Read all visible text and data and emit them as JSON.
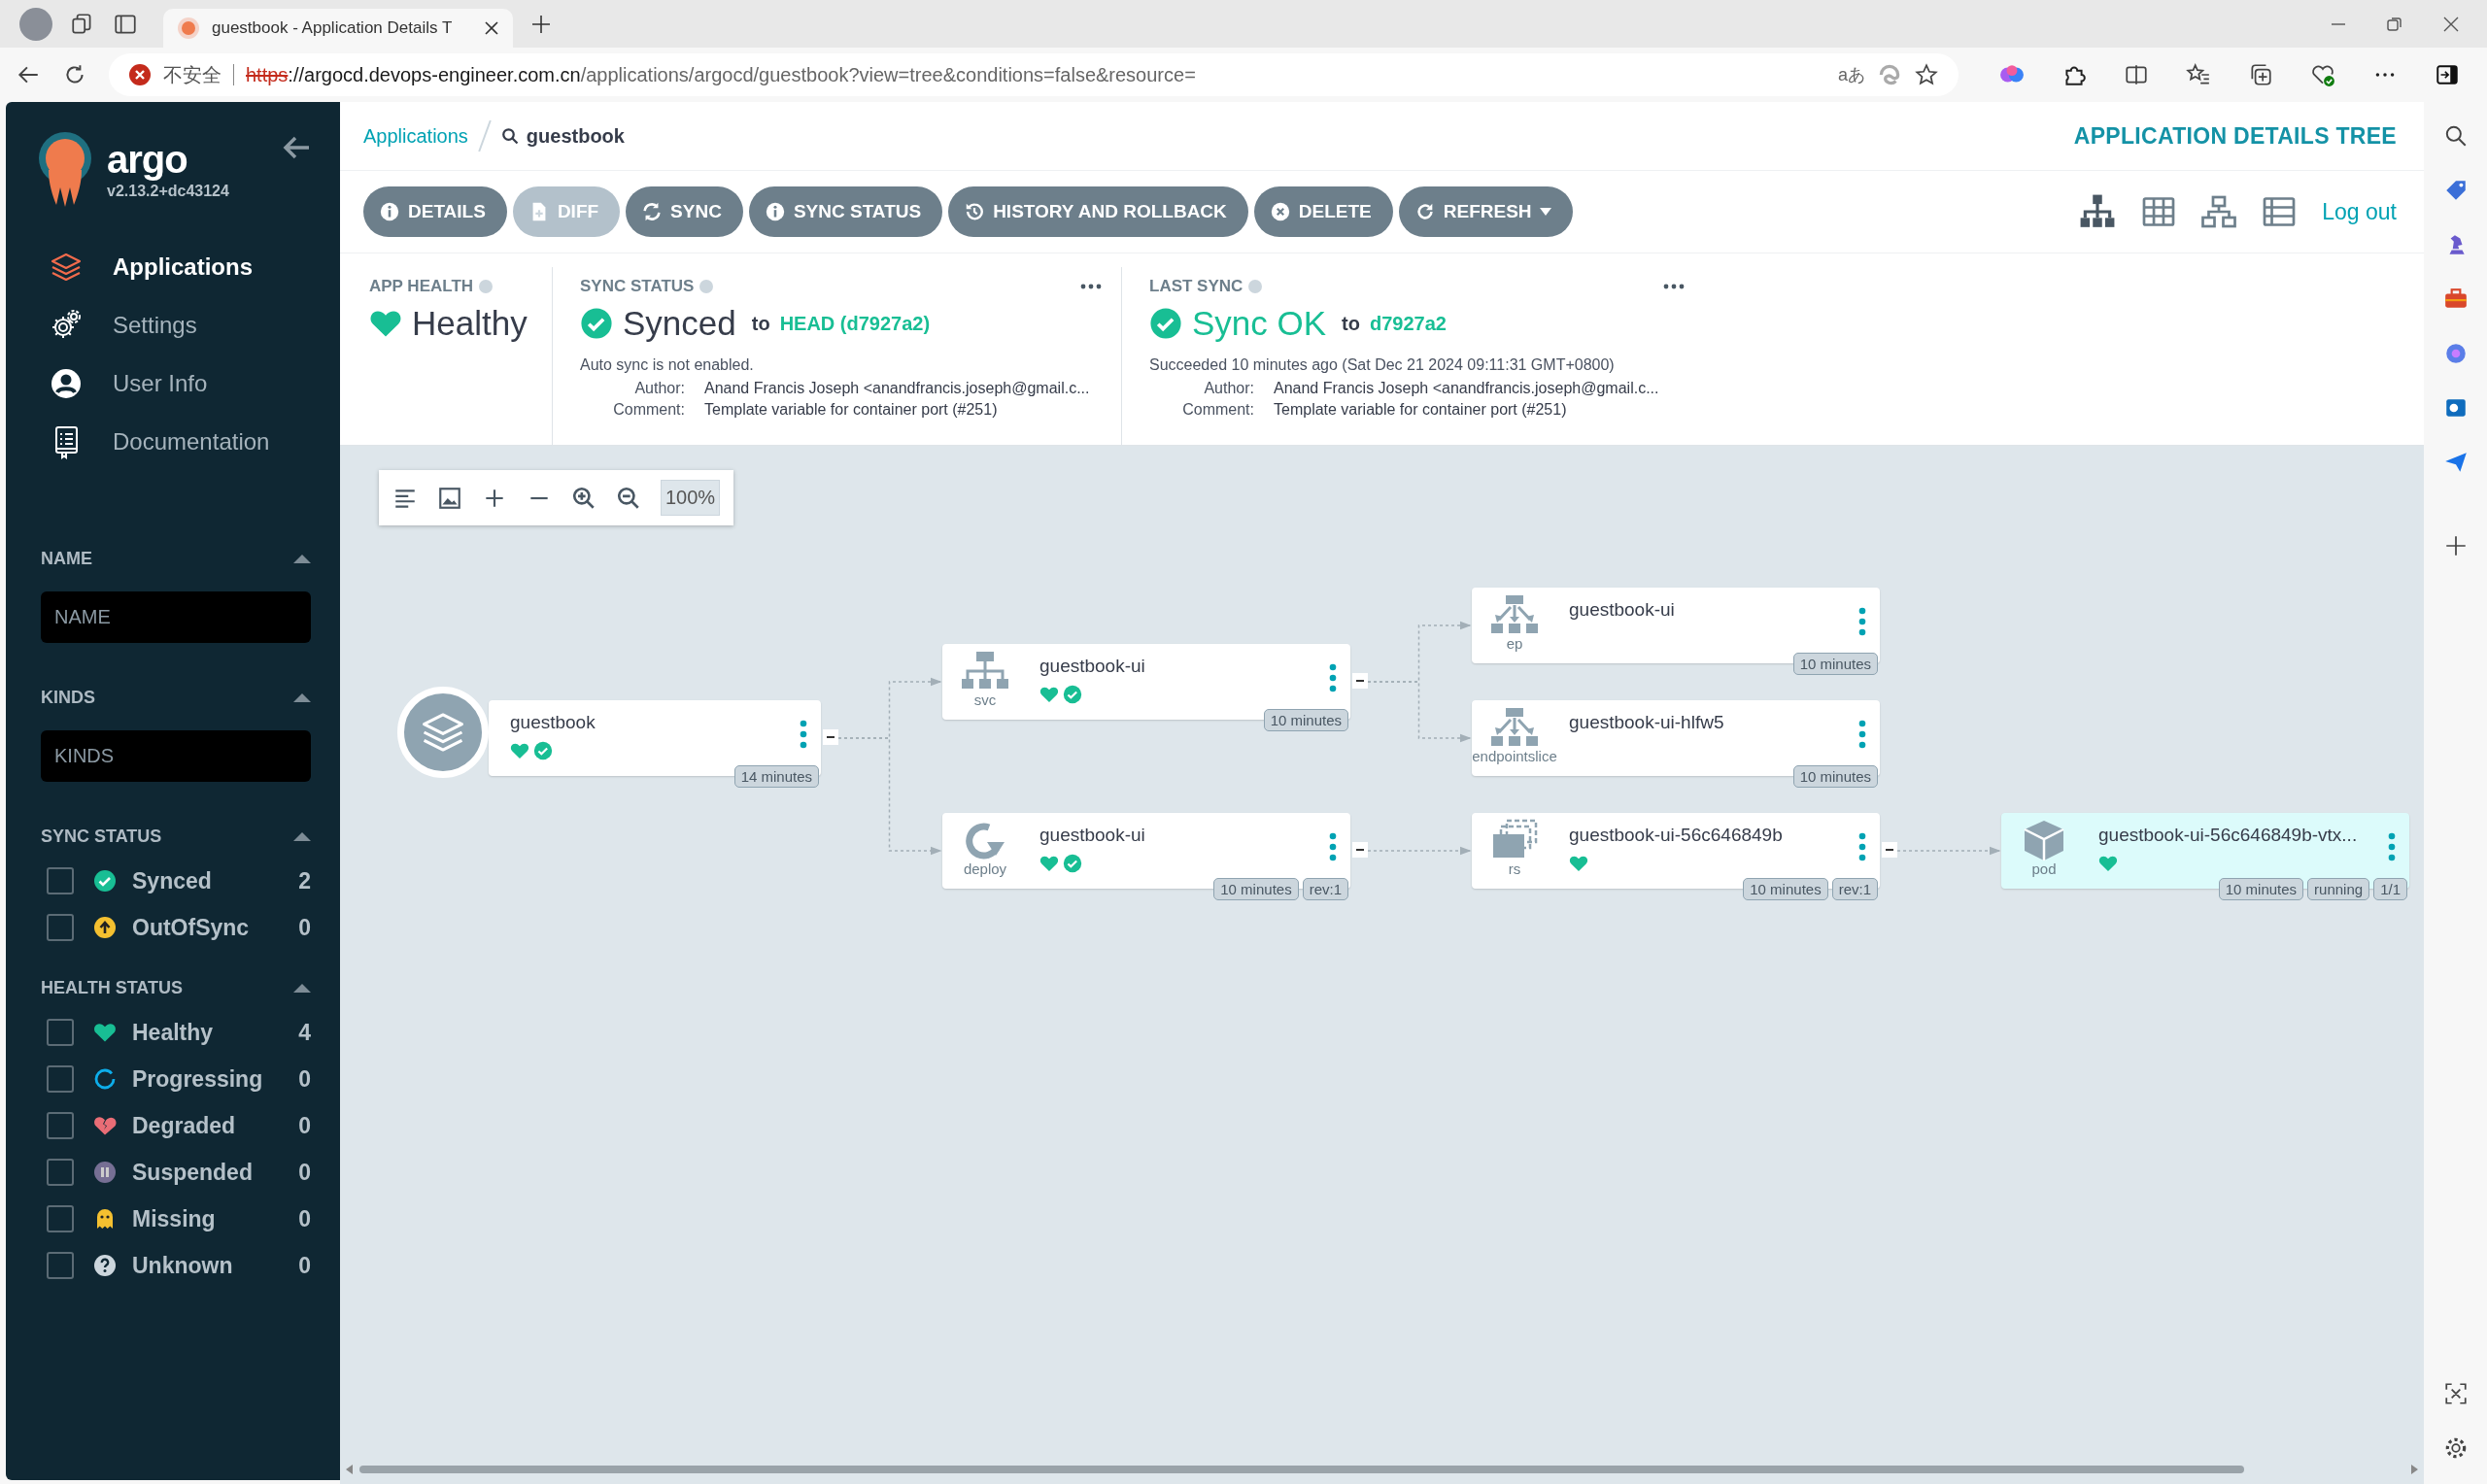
{
  "browser": {
    "tab_title": "guestbook - Application Details T",
    "security_label": "不安全",
    "url": {
      "scheme": "https",
      "host": "://argocd.devops-engineer.com.cn",
      "path": "/applications/argocd/guestbook?view=tree&conditions=false&resource="
    },
    "translate_glyph": "aあ"
  },
  "sidebar": {
    "brand": "argo",
    "version": "v2.13.2+dc43124",
    "nav": [
      {
        "kind": "applications",
        "label": "Applications",
        "selected": true
      },
      {
        "kind": "settings",
        "label": "Settings",
        "selected": false
      },
      {
        "kind": "user",
        "label": "User Info",
        "selected": false
      },
      {
        "kind": "docs",
        "label": "Documentation",
        "selected": false
      }
    ],
    "filters": [
      {
        "kind": "text",
        "title": "NAME",
        "placeholder": "NAME"
      },
      {
        "kind": "text",
        "title": "KINDS",
        "placeholder": "KINDS"
      },
      {
        "kind": "checklist",
        "title": "SYNC STATUS",
        "items": [
          {
            "kind": "synced",
            "label": "Synced",
            "count": "2",
            "checked": false
          },
          {
            "kind": "outofsync",
            "label": "OutOfSync",
            "count": "0",
            "checked": false
          }
        ]
      },
      {
        "kind": "checklist",
        "title": "HEALTH STATUS",
        "items": [
          {
            "kind": "healthy",
            "label": "Healthy",
            "count": "4",
            "checked": false
          },
          {
            "kind": "progressing",
            "label": "Progressing",
            "count": "0",
            "checked": false
          },
          {
            "kind": "degraded",
            "label": "Degraded",
            "count": "0",
            "checked": false
          },
          {
            "kind": "suspended",
            "label": "Suspended",
            "count": "0",
            "checked": false
          },
          {
            "kind": "missing",
            "label": "Missing",
            "count": "0",
            "checked": false
          },
          {
            "kind": "unknown",
            "label": "Unknown",
            "count": "0",
            "checked": false
          }
        ]
      }
    ]
  },
  "header": {
    "breadcrumb": [
      {
        "kind": "link",
        "label": "Applications"
      },
      {
        "kind": "search",
        "label": "guestbook"
      }
    ],
    "title": "APPLICATION DETAILS TREE",
    "actions": [
      {
        "kind": "details",
        "label": "DETAILS",
        "disabled": false
      },
      {
        "kind": "diff",
        "label": "DIFF",
        "disabled": true
      },
      {
        "kind": "sync",
        "label": "SYNC",
        "disabled": false
      },
      {
        "kind": "details",
        "label": "SYNC STATUS",
        "disabled": false
      },
      {
        "kind": "history",
        "label": "HISTORY AND ROLLBACK",
        "disabled": false
      },
      {
        "kind": "delete",
        "label": "DELETE",
        "disabled": false
      },
      {
        "kind": "refresh",
        "label": "REFRESH",
        "disabled": false
      }
    ],
    "logout": "Log out"
  },
  "status": {
    "app_health": {
      "title": "APP HEALTH",
      "value": "Healthy"
    },
    "sync_status": {
      "title": "SYNC STATUS",
      "value": "Synced",
      "to": "to",
      "revision": "HEAD (d7927a2)",
      "note": "Auto sync is not enabled.",
      "details": [
        {
          "label": "Author:",
          "value": "Anand Francis Joseph <anandfrancis.joseph@gmail.c..."
        },
        {
          "label": "Comment:",
          "value": "Template variable for container port (#251)"
        }
      ]
    },
    "last_sync": {
      "title": "LAST SYNC",
      "value": "Sync OK",
      "to": "to",
      "revision": "d7927a2",
      "note": "Succeeded 10 minutes ago (Sat Dec 21 2024 09:11:31 GMT+0800)",
      "details": [
        {
          "label": "Author:",
          "value": "Anand Francis Joseph <anandfrancis.joseph@gmail.c..."
        },
        {
          "label": "Comment:",
          "value": "Template variable for container port (#251)"
        }
      ]
    }
  },
  "graph": {
    "zoom": "100%",
    "root": {
      "kind": "application",
      "name": "guestbook",
      "healthy": true,
      "synced": true,
      "selected": false,
      "badges": [
        "14 minutes"
      ],
      "children": [
        {
          "kind": "svc",
          "type": "svc",
          "name": "guestbook-ui",
          "healthy": true,
          "synced": true,
          "selected": false,
          "badges": [
            "10 minutes"
          ],
          "children": [
            {
              "kind": "ep",
              "type": "ep",
              "name": "guestbook-ui",
              "healthy": false,
              "synced": false,
              "selected": false,
              "badges": [
                "10 minutes"
              ]
            },
            {
              "kind": "ep",
              "type": "endpointslice",
              "name": "guestbook-ui-hlfw5",
              "healthy": false,
              "synced": false,
              "selected": false,
              "badges": [
                "10 minutes"
              ]
            }
          ]
        },
        {
          "kind": "deploy",
          "type": "deploy",
          "name": "guestbook-ui",
          "healthy": true,
          "synced": true,
          "selected": false,
          "badges": [
            "10 minutes",
            "rev:1"
          ],
          "children": [
            {
              "kind": "rs",
              "type": "rs",
              "name": "guestbook-ui-56c646849b",
              "healthy": true,
              "synced": false,
              "selected": false,
              "badges": [
                "10 minutes",
                "rev:1"
              ],
              "children": [
                {
                  "kind": "pod",
                  "type": "pod",
                  "name": "guestbook-ui-56c646849b-vtx...",
                  "healthy": true,
                  "synced": false,
                  "selected": true,
                  "badges": [
                    "10 minutes",
                    "running",
                    "1/1"
                  ]
                }
              ]
            }
          ]
        }
      ]
    }
  }
}
